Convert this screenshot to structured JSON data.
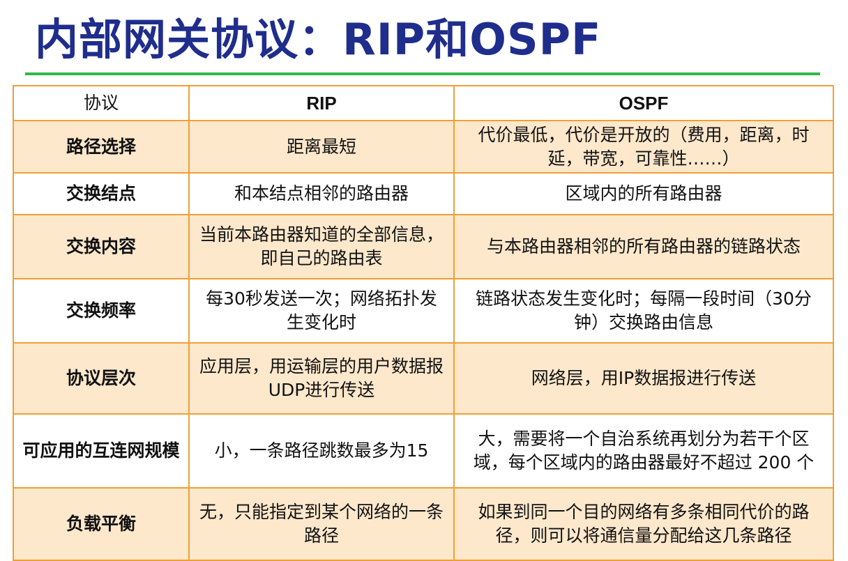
{
  "title": "内部网关协议：RIP和OSPF",
  "table": {
    "headers": [
      "协议",
      "RIP",
      "OSPF"
    ],
    "rows": [
      {
        "label": "路径选择",
        "rip": "距离最短",
        "ospf": "代价最低，代价是开放的（费用，距离，时延，带宽，可靠性……）"
      },
      {
        "label": "交换结点",
        "rip": "和本结点相邻的路由器",
        "ospf": "区域内的所有路由器"
      },
      {
        "label": "交换内容",
        "rip": "当前本路由器知道的全部信息，即自己的路由表",
        "ospf": "与本路由器相邻的所有路由器的链路状态"
      },
      {
        "label": "交换频率",
        "rip": "每30秒发送一次；网络拓扑发生变化时",
        "ospf": "链路状态发生变化时；每隔一段时间（30分钟）交换路由信息"
      },
      {
        "label": "协议层次",
        "rip": "应用层，用运输层的用户数据报UDP进行传送",
        "ospf": "网络层，用IP数据报进行传送"
      },
      {
        "label": "可应用的互连网规模",
        "rip": "小，一条路径跳数最多为15",
        "ospf": "大，需要将一个自治系统再划分为若干个区域，每个区域内的路由器最好不超过 200 个"
      },
      {
        "label": "负载平衡",
        "rip": "无，只能指定到某个网络的一条路径",
        "ospf": "如果到同一个目的网络有多条相同代价的路径，则可以将通信量分配给这几条路径"
      }
    ]
  }
}
